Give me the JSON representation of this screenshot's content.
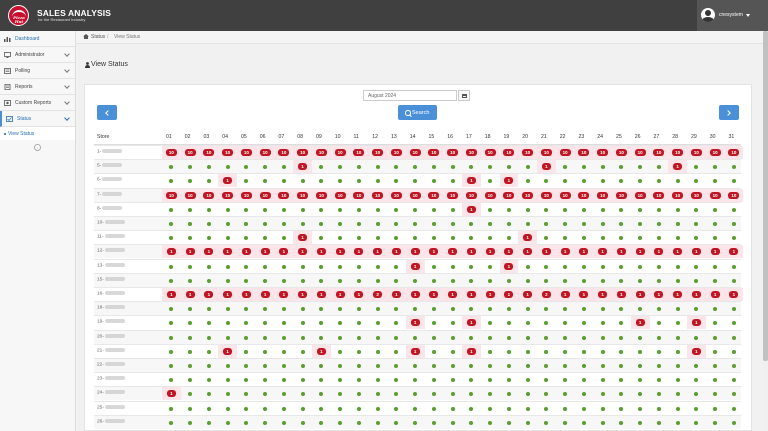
{
  "header": {
    "brand": "SALES ANALYSIS",
    "brand_sub": "for the Restaurant Industry",
    "logo_text": "Pizza Hut",
    "user": "cnesystem"
  },
  "sidebar": {
    "items": [
      {
        "label": "Dashboard",
        "icon": "chart-icon"
      },
      {
        "label": "Administrator",
        "icon": "monitor-icon"
      },
      {
        "label": "Polling",
        "icon": "polling-icon"
      },
      {
        "label": "Reports",
        "icon": "reports-icon"
      },
      {
        "label": "Custom Reports",
        "icon": "custom-reports-icon"
      },
      {
        "label": "Status",
        "icon": "status-icon"
      }
    ],
    "sub_item": "View Status"
  },
  "breadcrumb": {
    "home": "Status",
    "current": "View Status"
  },
  "page": {
    "title": "View Status"
  },
  "filter": {
    "month": "August 2024",
    "search_label": "Search"
  },
  "colors": {
    "accent": "#4a90d9",
    "ok": "#5a9e2f",
    "error": "#c01624",
    "header_bg": "#404040"
  },
  "table": {
    "store_header": "Store",
    "days": [
      "01",
      "02",
      "03",
      "04",
      "05",
      "06",
      "07",
      "08",
      "09",
      "10",
      "11",
      "12",
      "13",
      "14",
      "15",
      "16",
      "17",
      "18",
      "19",
      "20",
      "21",
      "22",
      "23",
      "24",
      "25",
      "26",
      "27",
      "28",
      "29",
      "30",
      "31"
    ],
    "rows": [
      {
        "store": "1-",
        "cells": [
          "10",
          "10",
          "10",
          "10",
          "10",
          "10",
          "10",
          "10",
          "10",
          "10",
          "10",
          "10",
          "10",
          "10",
          "10",
          "10",
          "10",
          "10",
          "10",
          "10",
          "10",
          "10",
          "10",
          "10",
          "10",
          "10",
          "10",
          "10",
          "10",
          "10",
          "10"
        ]
      },
      {
        "store": "5-",
        "cells": [
          "",
          "",
          "",
          "",
          "",
          "",
          "",
          "1",
          "",
          "",
          "",
          "",
          "",
          "",
          "",
          "",
          "",
          "",
          "",
          "",
          "1",
          "",
          "",
          "",
          "",
          "",
          "",
          "1",
          "",
          "",
          ""
        ]
      },
      {
        "store": "6-",
        "cells": [
          "",
          "",
          "",
          "1",
          "",
          "",
          "",
          "",
          "",
          "",
          "",
          "",
          "",
          "",
          "",
          "",
          "1",
          "",
          "1",
          "",
          "",
          "",
          "",
          "",
          "",
          "",
          "",
          "",
          "",
          "",
          ""
        ]
      },
      {
        "store": "7-",
        "cells": [
          "10",
          "10",
          "10",
          "10",
          "10",
          "10",
          "10",
          "10",
          "10",
          "10",
          "10",
          "10",
          "10",
          "10",
          "10",
          "10",
          "10",
          "10",
          "10",
          "10",
          "10",
          "10",
          "10",
          "10",
          "10",
          "10",
          "10",
          "10",
          "10",
          "10",
          "10"
        ]
      },
      {
        "store": "8-",
        "cells": [
          "",
          "",
          "",
          "",
          "",
          "",
          "",
          "",
          "",
          "",
          "",
          "",
          "",
          "",
          "",
          "",
          "1",
          "",
          "",
          "",
          "",
          "",
          "",
          "",
          "",
          "",
          "",
          "",
          "",
          "",
          ""
        ]
      },
      {
        "store": "10-",
        "cells": [
          "",
          "",
          "",
          "",
          "",
          "",
          "",
          "",
          "",
          "",
          "",
          "",
          "",
          "",
          "",
          "",
          "",
          "",
          "",
          "",
          "",
          "",
          "",
          "",
          "",
          "",
          "",
          "",
          "",
          "",
          ""
        ]
      },
      {
        "store": "11-",
        "cells": [
          "",
          "",
          "",
          "",
          "",
          "",
          "",
          "1",
          "",
          "",
          "",
          "",
          "",
          "",
          "",
          "",
          "",
          "",
          "",
          "1",
          "",
          "",
          "",
          "",
          "",
          "",
          "",
          "",
          "",
          "",
          ""
        ]
      },
      {
        "store": "12-",
        "cells": [
          "1",
          "1",
          "1",
          "1",
          "1",
          "1",
          "1",
          "1",
          "1",
          "1",
          "1",
          "1",
          "1",
          "1",
          "1",
          "1",
          "1",
          "1",
          "1",
          "1",
          "1",
          "1",
          "1",
          "1",
          "1",
          "1",
          "1",
          "1",
          "1",
          "1",
          "1"
        ]
      },
      {
        "store": "13-",
        "cells": [
          "",
          "",
          "",
          "",
          "",
          "",
          "",
          "",
          "",
          "",
          "",
          "",
          "",
          "1",
          "",
          "",
          "",
          "",
          "1",
          "",
          "",
          "",
          "",
          "",
          "",
          "",
          "",
          "",
          "",
          "",
          ""
        ]
      },
      {
        "store": "15-",
        "cells": [
          "",
          "",
          "",
          "",
          "",
          "",
          "",
          "",
          "",
          "",
          "",
          "",
          "",
          "",
          "",
          "",
          "",
          "",
          "",
          "",
          "",
          "",
          "",
          "",
          "",
          "",
          "",
          "",
          "",
          "",
          ""
        ]
      },
      {
        "store": "16-",
        "cells": [
          "1",
          "1",
          "1",
          "1",
          "1",
          "1",
          "1",
          "1",
          "1",
          "1",
          "1",
          "2",
          "1",
          "1",
          "1",
          "1",
          "1",
          "1",
          "1",
          "1",
          "2",
          "1",
          "1",
          "1",
          "1",
          "1",
          "1",
          "1",
          "1",
          "1",
          "1"
        ]
      },
      {
        "store": "18-",
        "cells": [
          "",
          "",
          "",
          "",
          "",
          "",
          "",
          "",
          "",
          "",
          "",
          "",
          "",
          "",
          "",
          "",
          "",
          "",
          "",
          "",
          "",
          "",
          "",
          "",
          "",
          "",
          "",
          "",
          "",
          "",
          ""
        ]
      },
      {
        "store": "19-",
        "cells": [
          "",
          "",
          "",
          "",
          "",
          "",
          "",
          "",
          "",
          "",
          "",
          "",
          "",
          "1",
          "",
          "",
          "1",
          "",
          "",
          "",
          "",
          "",
          "",
          "",
          "",
          "1",
          "",
          "",
          "1",
          "",
          ""
        ]
      },
      {
        "store": "20-",
        "cells": [
          "",
          "",
          "",
          "",
          "",
          "",
          "",
          "",
          "",
          "",
          "",
          "",
          "",
          "",
          "",
          "",
          "",
          "",
          "",
          "",
          "",
          "",
          "",
          "",
          "",
          "",
          "",
          "",
          "",
          "",
          ""
        ]
      },
      {
        "store": "21-",
        "cells": [
          "",
          "",
          "",
          "1",
          "",
          "",
          "",
          "",
          "1",
          "",
          "",
          "",
          "",
          "1",
          "",
          "",
          "1",
          "",
          "",
          "",
          "",
          "",
          "",
          "",
          "",
          "",
          "",
          "",
          "1",
          "",
          ""
        ]
      },
      {
        "store": "22-",
        "cells": [
          "",
          "",
          "",
          "",
          "",
          "",
          "",
          "",
          "",
          "",
          "",
          "",
          "",
          "",
          "",
          "",
          "",
          "",
          "",
          "",
          "",
          "",
          "",
          "",
          "",
          "",
          "",
          "",
          "",
          "",
          ""
        ]
      },
      {
        "store": "23-",
        "cells": [
          "",
          "",
          "",
          "",
          "",
          "",
          "",
          "",
          "",
          "",
          "",
          "",
          "",
          "",
          "",
          "",
          "",
          "",
          "",
          "",
          "",
          "",
          "",
          "",
          "",
          "",
          "",
          "",
          "",
          "",
          ""
        ]
      },
      {
        "store": "24-",
        "cells": [
          "1",
          "",
          "",
          "",
          "",
          "",
          "",
          "",
          "",
          "",
          "",
          "",
          "",
          "",
          "",
          "",
          "",
          "",
          "",
          "",
          "",
          "",
          "",
          "",
          "",
          "",
          "",
          "",
          "",
          "",
          ""
        ]
      },
      {
        "store": "25-",
        "cells": [
          "",
          "",
          "",
          "",
          "",
          "",
          "",
          "",
          "",
          "",
          "",
          "",
          "",
          "",
          "",
          "",
          "",
          "",
          "",
          "",
          "",
          "",
          "",
          "",
          "",
          "",
          "",
          "",
          "",
          "",
          ""
        ]
      },
      {
        "store": "26-",
        "cells": [
          "",
          "",
          "",
          "",
          "",
          "",
          "",
          "",
          "",
          "",
          "",
          "",
          "",
          "",
          "",
          "",
          "",
          "",
          "",
          "",
          "",
          "",
          "",
          "",
          "",
          "",
          "",
          "",
          "",
          "",
          ""
        ]
      }
    ]
  }
}
